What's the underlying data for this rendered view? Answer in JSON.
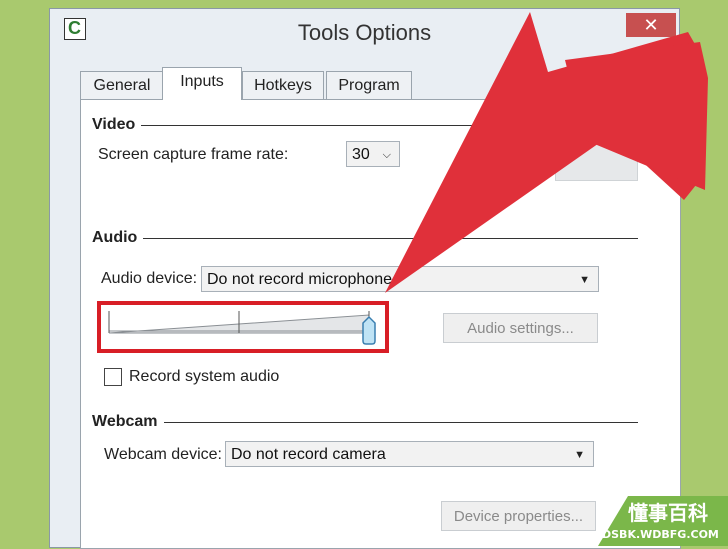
{
  "window": {
    "title": "Tools Options",
    "close_glyph": "✕",
    "icon": "camtasia-app-icon"
  },
  "tabs": [
    {
      "label": "General",
      "active": false
    },
    {
      "label": "Inputs",
      "active": true
    },
    {
      "label": "Hotkeys",
      "active": false
    },
    {
      "label": "Program",
      "active": false
    }
  ],
  "video": {
    "heading": "Video",
    "frame_rate_label": "Screen capture frame rate:",
    "frame_rate_value": "30"
  },
  "audio": {
    "heading": "Audio",
    "device_label": "Audio device:",
    "device_value": "Do not record microphone",
    "volume_level": 1.0,
    "settings_button": "Audio settings...",
    "record_system_label": "Record system audio",
    "record_system_checked": false
  },
  "webcam": {
    "heading": "Webcam",
    "device_label": "Webcam device:",
    "device_value": "Do not record camera",
    "properties_button": "Device properties..."
  },
  "watermark": {
    "title": "懂事百科",
    "url": "DSBK.WDBFG.COM"
  },
  "colors": {
    "arrow": "#e0303a",
    "highlight": "#d81e26",
    "background": "#a9c96e"
  }
}
